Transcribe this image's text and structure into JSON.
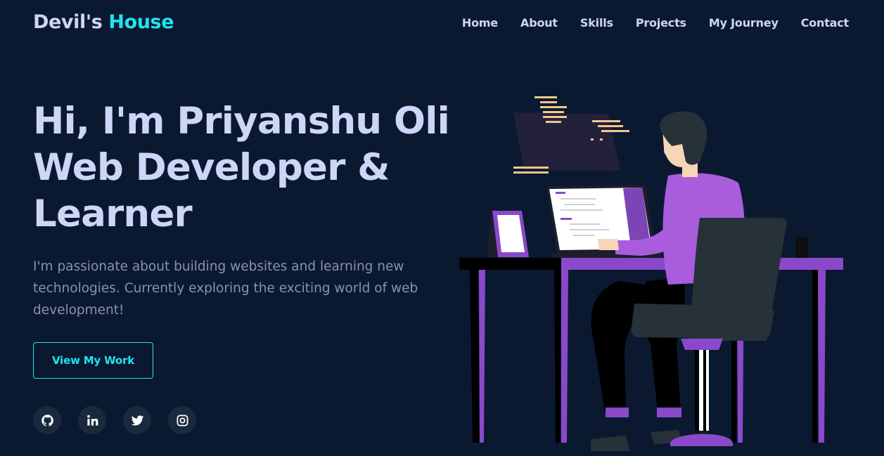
{
  "brand": {
    "name": "Devil's",
    "accent": "House"
  },
  "nav": {
    "items": [
      "Home",
      "About",
      "Skills",
      "Projects",
      "My Journey",
      "Contact"
    ]
  },
  "hero": {
    "title": "Hi, I'm Priyanshu Oli Web Developer & Learner",
    "description": "I'm passionate about building websites and learning new technologies. Currently exploring the exciting world of web development!",
    "cta_label": "View My Work"
  },
  "socials": [
    "github-icon",
    "linkedin-icon",
    "twitter-icon",
    "instagram-icon"
  ],
  "colors": {
    "background": "#0b1930",
    "accent": "#1ee4ef",
    "text": "#ccd6f6",
    "muted": "#8892b0",
    "illustration_purple": "#8a49c8"
  }
}
